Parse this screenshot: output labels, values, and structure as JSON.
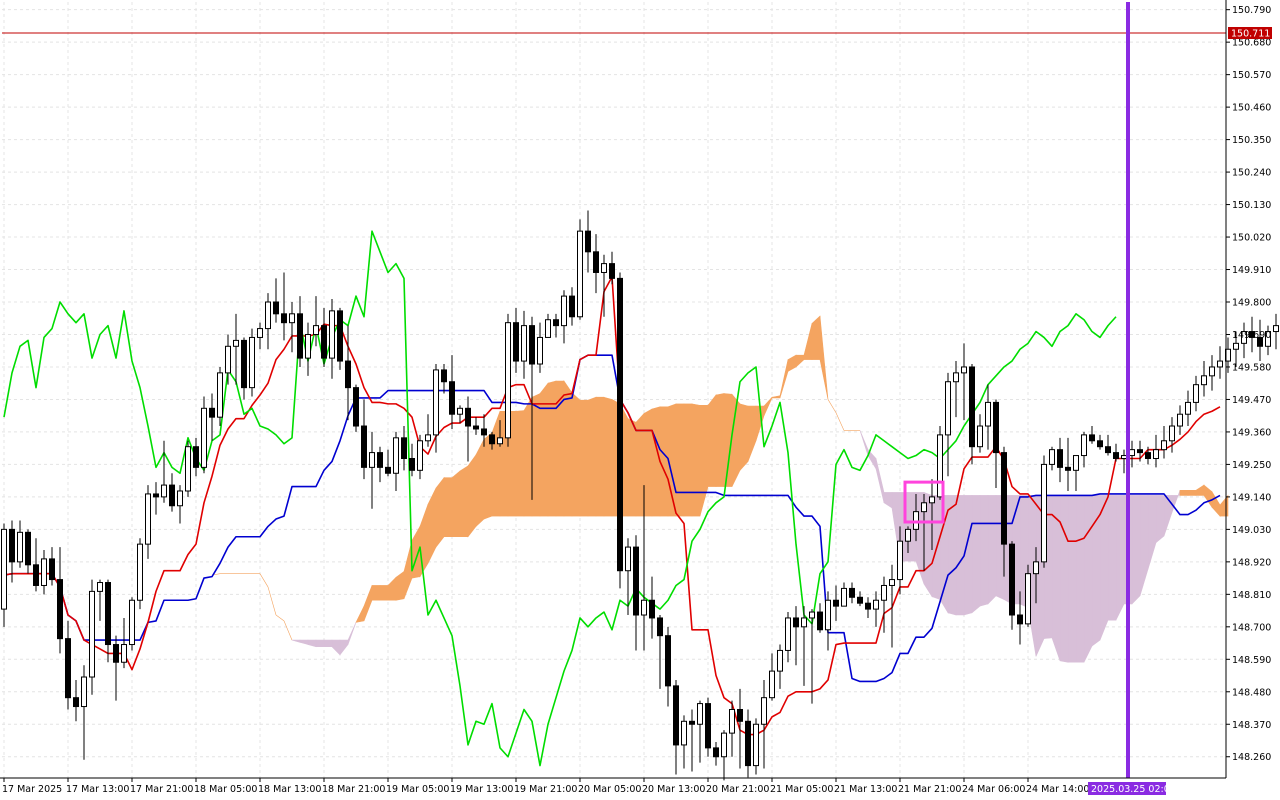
{
  "chart_data": {
    "type": "candlestick",
    "symbol": "",
    "title": "",
    "indicator": "Ichimoku Kinko Hyo",
    "grid": true,
    "y_axis": {
      "position": "right",
      "range": [
        148.188,
        150.816
      ],
      "ticks": [
        "150.790",
        "150.680",
        "150.570",
        "150.460",
        "150.350",
        "150.240",
        "150.130",
        "150.020",
        "149.910",
        "149.800",
        "149.690",
        "149.580",
        "149.470",
        "149.360",
        "149.250",
        "149.140",
        "149.030",
        "148.920",
        "148.810",
        "148.700",
        "148.590",
        "148.480",
        "148.370",
        "148.260"
      ]
    },
    "x_axis": {
      "labels": [
        "17 Mar 2025",
        "17 Mar 13:00",
        "17 Mar 21:00",
        "18 Mar 05:00",
        "18 Mar 13:00",
        "18 Mar 21:00",
        "19 Mar 05:00",
        "19 Mar 13:00",
        "19 Mar 21:00",
        "20 Mar 05:00",
        "20 Mar 13:00",
        "20 Mar 21:00",
        "21 Mar 05:00",
        "21 Mar 13:00",
        "21 Mar 21:00",
        "24 Mar 06:00",
        "24 Mar 14:00"
      ],
      "bars_between_labels": 8
    },
    "current_price": {
      "value": 150.711,
      "label": "150.711",
      "color": "#c00000"
    },
    "vertical_marker": {
      "label": "2025.03.25 02:00",
      "color": "#8a2be2",
      "after_bar": 140
    },
    "highlight_box": {
      "from_bar": 113,
      "to_bar": 117,
      "y_low": 149.055,
      "y_high": 149.19,
      "color": "#ff44dd"
    },
    "colors": {
      "tenkan_sen": "#e00000",
      "kijun_sen": "#0000d0",
      "chikou_span": "#00dd00",
      "kumo_bullish": "#f4a460",
      "kumo_bearish": "#d8bfd8",
      "candle_bull": "#ffffff",
      "candle_bear": "#000000"
    },
    "candles": [
      [
        148.76,
        149.05,
        148.7,
        149.03
      ],
      [
        149.03,
        149.06,
        148.85,
        148.92
      ],
      [
        148.92,
        149.06,
        148.9,
        149.02
      ],
      [
        149.02,
        149.03,
        148.88,
        148.91
      ],
      [
        148.91,
        149.0,
        148.82,
        148.84
      ],
      [
        148.84,
        148.96,
        148.81,
        148.93
      ],
      [
        148.93,
        148.97,
        148.84,
        148.86
      ],
      [
        148.86,
        148.97,
        148.61,
        148.66
      ],
      [
        148.66,
        148.72,
        148.42,
        148.46
      ],
      [
        148.46,
        148.52,
        148.38,
        148.43
      ],
      [
        148.43,
        148.57,
        148.25,
        148.53
      ],
      [
        148.53,
        148.86,
        148.47,
        148.82
      ],
      [
        148.82,
        148.86,
        148.72,
        148.85
      ],
      [
        148.85,
        148.86,
        148.58,
        148.64
      ],
      [
        148.64,
        148.67,
        148.45,
        148.58
      ],
      [
        148.58,
        148.73,
        148.56,
        148.64
      ],
      [
        148.64,
        148.8,
        148.62,
        148.79
      ],
      [
        148.79,
        149.0,
        148.76,
        148.98
      ],
      [
        148.98,
        149.18,
        148.93,
        149.15
      ],
      [
        149.15,
        149.19,
        149.08,
        149.14
      ],
      [
        149.14,
        149.33,
        149.12,
        149.18
      ],
      [
        149.18,
        149.22,
        149.09,
        149.11
      ],
      [
        149.11,
        149.18,
        149.05,
        149.16
      ],
      [
        149.16,
        149.33,
        149.14,
        149.31
      ],
      [
        149.31,
        149.34,
        149.21,
        149.24
      ],
      [
        149.24,
        149.48,
        149.22,
        149.44
      ],
      [
        149.44,
        149.49,
        149.33,
        149.41
      ],
      [
        149.41,
        149.58,
        149.38,
        149.56
      ],
      [
        149.56,
        149.69,
        149.52,
        149.65
      ],
      [
        149.65,
        149.76,
        149.52,
        149.67
      ],
      [
        149.67,
        149.68,
        149.47,
        149.51
      ],
      [
        149.51,
        149.71,
        149.48,
        149.68
      ],
      [
        149.68,
        149.73,
        149.64,
        149.71
      ],
      [
        149.71,
        149.83,
        149.64,
        149.8
      ],
      [
        149.8,
        149.88,
        149.73,
        149.76
      ],
      [
        149.76,
        149.9,
        149.67,
        149.73
      ],
      [
        149.73,
        149.8,
        149.63,
        149.76
      ],
      [
        149.76,
        149.82,
        149.58,
        149.61
      ],
      [
        149.61,
        149.73,
        149.55,
        149.69
      ],
      [
        149.69,
        149.82,
        149.65,
        149.72
      ],
      [
        149.72,
        149.78,
        149.58,
        149.61
      ],
      [
        149.61,
        149.81,
        149.54,
        149.77
      ],
      [
        149.77,
        149.78,
        149.57,
        149.6
      ],
      [
        149.6,
        149.72,
        149.4,
        149.51
      ],
      [
        149.51,
        149.52,
        149.36,
        149.38
      ],
      [
        149.38,
        149.47,
        149.2,
        149.24
      ],
      [
        149.24,
        149.36,
        149.1,
        149.29
      ],
      [
        149.29,
        149.31,
        149.19,
        149.24
      ],
      [
        149.24,
        149.3,
        149.21,
        149.22
      ],
      [
        149.22,
        149.36,
        149.16,
        149.34
      ],
      [
        149.34,
        149.38,
        149.23,
        149.27
      ],
      [
        149.27,
        149.32,
        149.21,
        149.23
      ],
      [
        149.23,
        149.35,
        149.2,
        149.33
      ],
      [
        149.33,
        149.42,
        149.31,
        149.35
      ],
      [
        149.35,
        149.59,
        149.29,
        149.57
      ],
      [
        149.57,
        149.59,
        149.49,
        149.53
      ],
      [
        149.53,
        149.62,
        149.37,
        149.42
      ],
      [
        149.42,
        149.45,
        149.39,
        149.44
      ],
      [
        149.44,
        149.48,
        149.26,
        149.38
      ],
      [
        149.38,
        149.41,
        149.35,
        149.37
      ],
      [
        149.37,
        149.42,
        149.31,
        149.35
      ],
      [
        149.35,
        149.36,
        149.3,
        149.32
      ],
      [
        149.32,
        149.4,
        149.31,
        149.34
      ],
      [
        149.34,
        149.76,
        149.31,
        149.73
      ],
      [
        149.73,
        149.78,
        149.56,
        149.6
      ],
      [
        149.6,
        149.77,
        149.54,
        149.72
      ],
      [
        149.72,
        149.75,
        149.13,
        149.59
      ],
      [
        149.59,
        149.73,
        149.56,
        149.68
      ],
      [
        149.68,
        149.76,
        149.68,
        149.74
      ],
      [
        149.74,
        149.76,
        149.68,
        149.72
      ],
      [
        149.72,
        149.84,
        149.66,
        149.82
      ],
      [
        149.82,
        149.85,
        149.72,
        149.75
      ],
      [
        149.75,
        150.08,
        149.74,
        150.04
      ],
      [
        150.04,
        150.11,
        149.9,
        149.97
      ],
      [
        149.97,
        150.03,
        149.83,
        149.9
      ],
      [
        149.9,
        149.96,
        149.75,
        149.93
      ],
      [
        149.93,
        149.97,
        149.86,
        149.88
      ],
      [
        149.88,
        149.9,
        148.83,
        148.89
      ],
      [
        148.89,
        149.0,
        148.74,
        148.97
      ],
      [
        148.97,
        149.01,
        148.62,
        148.74
      ],
      [
        148.74,
        149.18,
        148.62,
        148.79
      ],
      [
        148.79,
        148.87,
        148.66,
        148.73
      ],
      [
        148.73,
        148.74,
        148.49,
        148.67
      ],
      [
        148.67,
        148.7,
        148.43,
        148.5
      ],
      [
        148.5,
        148.52,
        148.2,
        148.3
      ],
      [
        148.3,
        148.4,
        148.22,
        148.38
      ],
      [
        148.38,
        148.42,
        148.21,
        148.37
      ],
      [
        148.37,
        148.45,
        148.24,
        148.44
      ],
      [
        148.44,
        148.46,
        148.26,
        148.29
      ],
      [
        148.29,
        148.31,
        148.23,
        148.26
      ],
      [
        148.26,
        148.35,
        148.18,
        148.34
      ],
      [
        148.34,
        148.45,
        148.26,
        148.42
      ],
      [
        148.42,
        148.49,
        148.22,
        148.38
      ],
      [
        148.38,
        148.42,
        148.19,
        148.23
      ],
      [
        148.23,
        148.39,
        148.2,
        148.37
      ],
      [
        148.37,
        148.52,
        148.22,
        148.46
      ],
      [
        148.46,
        148.61,
        148.45,
        148.55
      ],
      [
        148.55,
        148.64,
        148.49,
        148.62
      ],
      [
        148.62,
        148.75,
        148.58,
        148.73
      ],
      [
        148.73,
        148.77,
        148.57,
        148.7
      ],
      [
        148.7,
        148.77,
        148.5,
        148.73
      ],
      [
        148.73,
        148.76,
        148.44,
        148.75
      ],
      [
        148.75,
        148.78,
        148.68,
        148.69
      ],
      [
        148.69,
        148.82,
        148.62,
        148.79
      ],
      [
        148.79,
        148.84,
        148.72,
        148.77
      ],
      [
        148.77,
        148.85,
        148.77,
        148.83
      ],
      [
        148.83,
        148.85,
        148.78,
        148.8
      ],
      [
        148.8,
        148.82,
        148.77,
        148.78
      ],
      [
        148.78,
        148.8,
        148.73,
        148.76
      ],
      [
        148.76,
        148.82,
        148.7,
        148.79
      ],
      [
        148.79,
        148.87,
        148.68,
        148.84
      ],
      [
        148.84,
        148.91,
        148.63,
        148.86
      ],
      [
        148.86,
        149.04,
        148.81,
        148.99
      ],
      [
        148.99,
        149.04,
        148.95,
        149.03
      ],
      [
        149.03,
        149.15,
        148.99,
        149.09
      ],
      [
        149.09,
        149.15,
        148.89,
        149.12
      ],
      [
        149.12,
        149.2,
        148.96,
        149.14
      ],
      [
        149.14,
        149.38,
        149.13,
        149.35
      ],
      [
        149.35,
        149.56,
        149.21,
        149.53
      ],
      [
        149.53,
        149.6,
        149.41,
        149.56
      ],
      [
        149.56,
        149.66,
        149.4,
        149.58
      ],
      [
        149.58,
        149.59,
        149.25,
        149.31
      ],
      [
        149.31,
        149.42,
        149.29,
        149.38
      ],
      [
        149.38,
        149.52,
        149.3,
        149.46
      ],
      [
        149.46,
        149.47,
        149.17,
        149.29
      ],
      [
        149.29,
        149.31,
        148.87,
        148.98
      ],
      [
        148.98,
        148.99,
        148.69,
        148.74
      ],
      [
        148.74,
        148.82,
        148.64,
        148.71
      ],
      [
        148.71,
        148.91,
        148.7,
        148.88
      ],
      [
        148.88,
        148.97,
        148.78,
        148.92
      ],
      [
        148.92,
        149.28,
        148.9,
        149.25
      ],
      [
        149.25,
        149.31,
        149.23,
        149.3
      ],
      [
        149.3,
        149.34,
        149.19,
        149.24
      ],
      [
        149.24,
        149.34,
        149.16,
        149.23
      ],
      [
        149.23,
        149.28,
        149.16,
        149.28
      ],
      [
        149.28,
        149.36,
        149.24,
        149.35
      ],
      [
        149.35,
        149.38,
        149.32,
        149.33
      ],
      [
        149.33,
        149.35,
        149.3,
        149.31
      ],
      [
        149.31,
        149.35,
        149.28,
        149.29
      ],
      [
        149.29,
        149.32,
        149.26,
        149.27
      ],
      [
        149.27,
        149.3,
        149.22,
        149.28
      ],
      [
        149.28,
        149.33,
        149.24,
        149.3
      ],
      [
        149.3,
        149.33,
        149.26,
        149.29
      ],
      [
        149.29,
        149.31,
        149.25,
        149.27
      ],
      [
        149.27,
        149.35,
        149.24,
        149.3
      ],
      [
        149.3,
        149.38,
        149.27,
        149.33
      ],
      [
        149.33,
        149.41,
        149.29,
        149.38
      ],
      [
        149.38,
        149.45,
        149.35,
        149.42
      ],
      [
        149.42,
        149.5,
        149.38,
        149.46
      ],
      [
        149.46,
        149.55,
        149.43,
        149.52
      ],
      [
        149.52,
        149.6,
        149.48,
        149.55
      ],
      [
        149.55,
        149.62,
        149.5,
        149.58
      ],
      [
        149.58,
        149.65,
        149.54,
        149.6
      ],
      [
        149.6,
        149.68,
        149.56,
        149.64
      ],
      [
        149.64,
        149.7,
        149.58,
        149.66
      ],
      [
        149.66,
        149.73,
        149.61,
        149.7
      ],
      [
        149.7,
        149.75,
        149.63,
        149.68
      ],
      [
        149.68,
        149.74,
        149.6,
        149.65
      ],
      [
        149.65,
        149.72,
        149.62,
        149.7
      ],
      [
        149.7,
        149.76,
        149.64,
        149.72
      ],
      [
        149.72,
        149.79,
        149.69,
        149.76
      ],
      [
        149.76,
        149.8,
        149.7,
        149.74
      ],
      [
        149.74,
        149.78,
        149.66,
        149.7
      ],
      [
        149.7,
        149.75,
        149.62,
        149.68
      ],
      [
        149.68,
        149.73,
        149.6,
        149.72
      ],
      [
        149.72,
        149.77,
        149.7,
        149.75
      ]
    ]
  }
}
